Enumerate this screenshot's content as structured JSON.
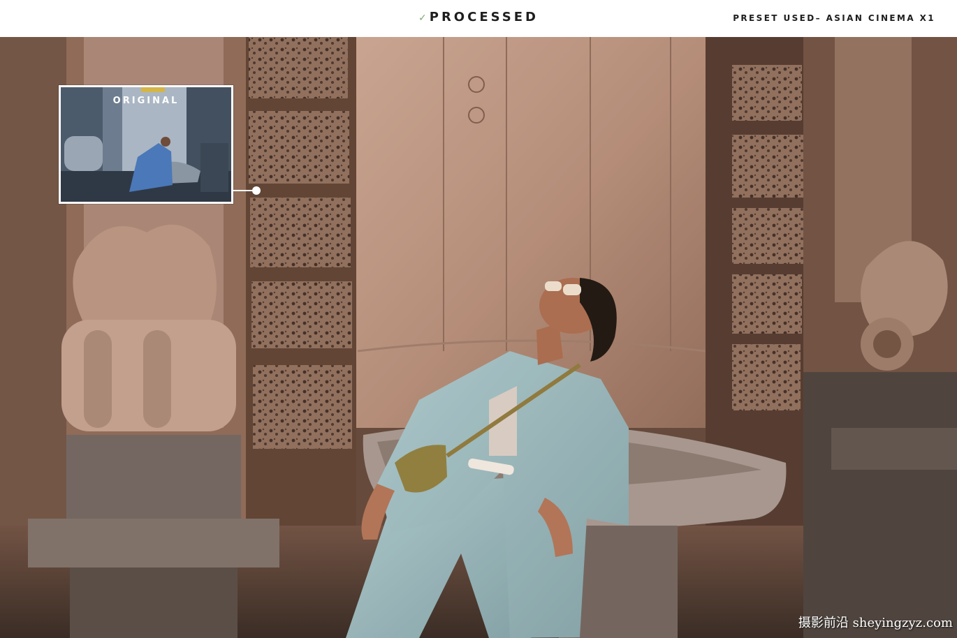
{
  "header": {
    "status_label": "PROCESSED",
    "preset_label": "PRESET USED– ASIAN CINEMA X1"
  },
  "inset": {
    "label": "ORIGINAL"
  },
  "watermark": {
    "text": "摄影前沿 sheyingzyz.com"
  },
  "colors": {
    "accent_check": "#7fa86f",
    "inset_tab": "#d4b54a",
    "suit_blue": "#9fc2c9"
  }
}
